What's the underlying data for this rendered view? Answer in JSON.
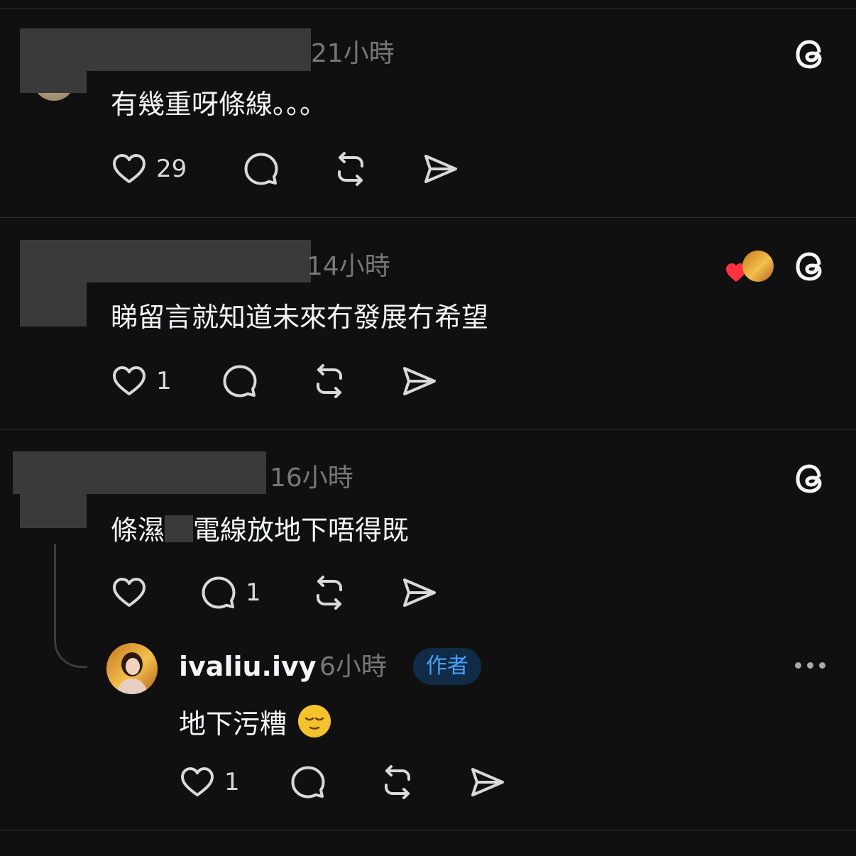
{
  "posts": [
    {
      "time": "21小時",
      "text": "有幾重呀條線。。。",
      "likes": "29",
      "replies": "",
      "icons": [
        "heart-icon",
        "comment-icon",
        "repost-icon",
        "share-icon",
        "threads-icon"
      ]
    },
    {
      "time": "14小時",
      "text": "睇留言就知道未來冇發展冇希望",
      "likes": "1",
      "replies": "",
      "author_liked": true,
      "icons": [
        "heart-icon",
        "comment-icon",
        "repost-icon",
        "share-icon",
        "threads-icon"
      ]
    },
    {
      "time": "16小時",
      "text_before": "條濕",
      "text_after": "電線放地下唔得既",
      "likes": "",
      "replies": "1",
      "icons": [
        "heart-icon",
        "comment-icon",
        "repost-icon",
        "share-icon",
        "threads-icon"
      ]
    }
  ],
  "reply": {
    "username": "ivaliu.ivy",
    "time": "6小時",
    "badge": "作者",
    "text": "地下污糟",
    "emoji": "sleepy-face",
    "likes": "1",
    "icons": [
      "heart-icon",
      "comment-icon",
      "repost-icon",
      "share-icon",
      "more-icon"
    ]
  },
  "colors": {
    "background": "#101010",
    "text": "#f3f5f7",
    "muted": "#777777",
    "badge_bg": "#0f2b45",
    "badge_text": "#4aa0ff",
    "like_red": "#ff3040"
  }
}
